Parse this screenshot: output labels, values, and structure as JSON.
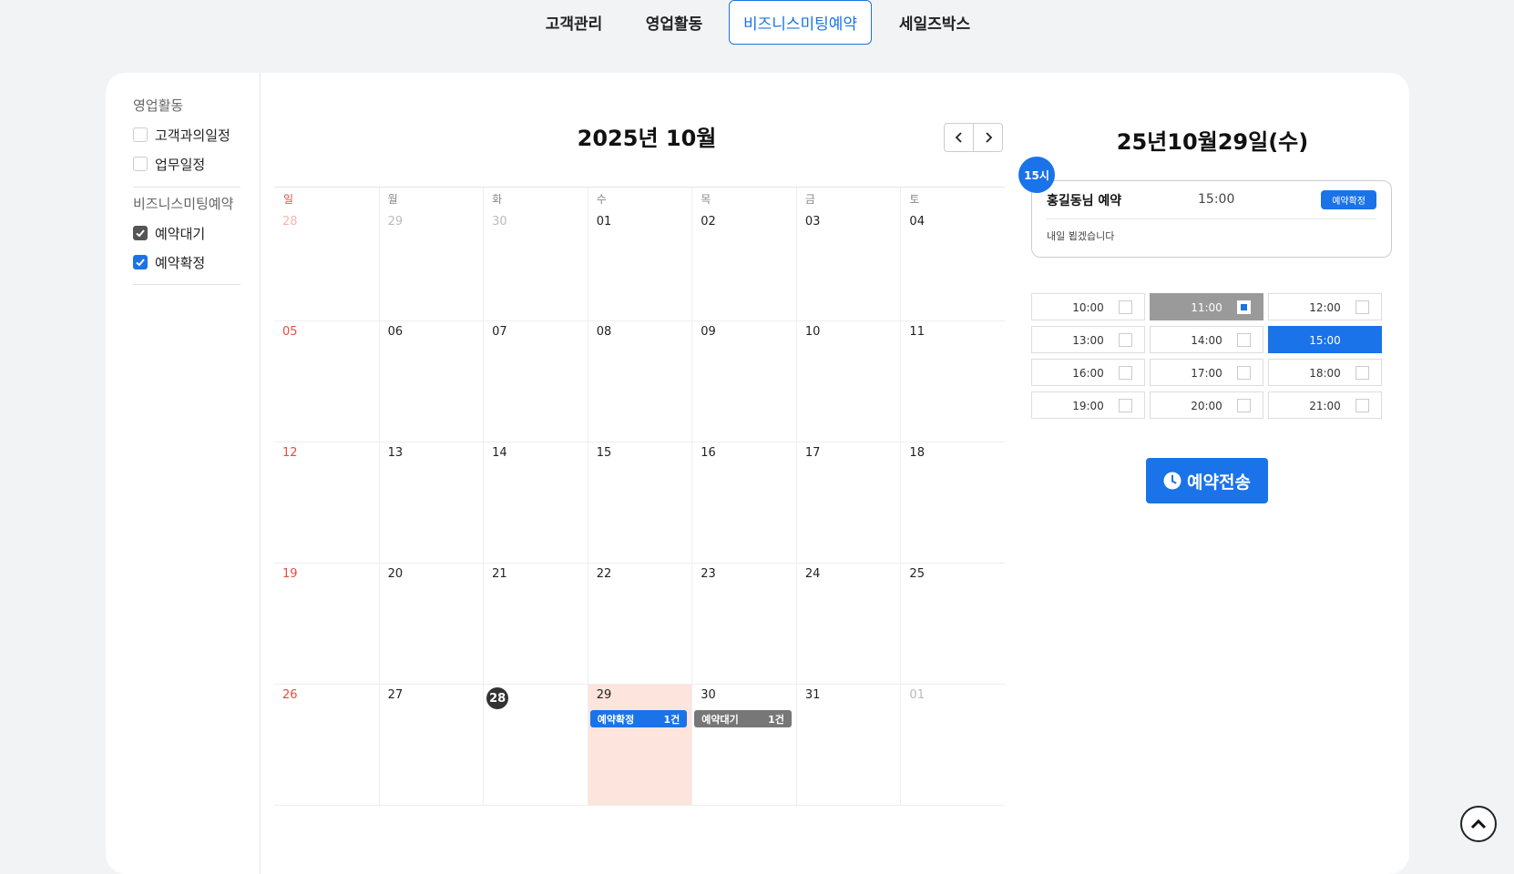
{
  "nav": {
    "tabs": [
      {
        "label": "고객관리"
      },
      {
        "label": "영업활동"
      },
      {
        "label": "비즈니스미팅예약"
      },
      {
        "label": "세일즈박스"
      }
    ]
  },
  "sidebar": {
    "groups": [
      {
        "title": "영업활동",
        "items": [
          {
            "label": "고객과의일정",
            "checked": false
          },
          {
            "label": "업무일정",
            "checked": false
          }
        ]
      },
      {
        "title": "비즈니스미팅예약",
        "items": [
          {
            "label": "예약대기",
            "checked": true
          },
          {
            "label": "예약확정",
            "checked": true
          }
        ]
      }
    ]
  },
  "calendar": {
    "title": "2025년 10월",
    "weekdays": [
      "일",
      "월",
      "화",
      "수",
      "목",
      "금",
      "토"
    ],
    "weeks": [
      [
        "28",
        "29",
        "30",
        "01",
        "02",
        "03",
        "04"
      ],
      [
        "05",
        "06",
        "07",
        "08",
        "09",
        "10",
        "11"
      ],
      [
        "12",
        "13",
        "14",
        "15",
        "16",
        "17",
        "18"
      ],
      [
        "19",
        "20",
        "21",
        "22",
        "23",
        "24",
        "25"
      ],
      [
        "26",
        "27",
        "28",
        "29",
        "30",
        "31",
        "01"
      ]
    ],
    "today": "28",
    "selected": "29",
    "events": [
      {
        "day": "29",
        "label": "예약확정",
        "count": "1건",
        "color": "#1a73e8"
      },
      {
        "day": "30",
        "label": "예약대기",
        "count": "1건",
        "color": "#777777"
      }
    ]
  },
  "detail": {
    "date_title": "25년10월29일(수)",
    "booking": {
      "hour_badge": "15시",
      "name": "홍길동님 예약",
      "time": "15:00",
      "status": "예약확정",
      "memo": "내일 뵙겠습니다"
    },
    "time_slots": [
      {
        "label": "10:00",
        "state": "available"
      },
      {
        "label": "11:00",
        "state": "disabled"
      },
      {
        "label": "12:00",
        "state": "available"
      },
      {
        "label": "13:00",
        "state": "available"
      },
      {
        "label": "14:00",
        "state": "available"
      },
      {
        "label": "15:00",
        "state": "selected"
      },
      {
        "label": "16:00",
        "state": "available"
      },
      {
        "label": "17:00",
        "state": "available"
      },
      {
        "label": "18:00",
        "state": "available"
      },
      {
        "label": "19:00",
        "state": "available"
      },
      {
        "label": "20:00",
        "state": "available"
      },
      {
        "label": "21:00",
        "state": "available"
      }
    ],
    "submit_label": "예약전송"
  },
  "colors": {
    "accent": "#1a73e8",
    "sunday": "#e74c3c",
    "selected_day_bg": "#fde4dc",
    "pending": "#777777"
  },
  "icons": {
    "prev": "chevron-left-icon",
    "next": "chevron-right-icon",
    "submit": "clock-icon",
    "scroll_top": "chevron-up-icon"
  }
}
